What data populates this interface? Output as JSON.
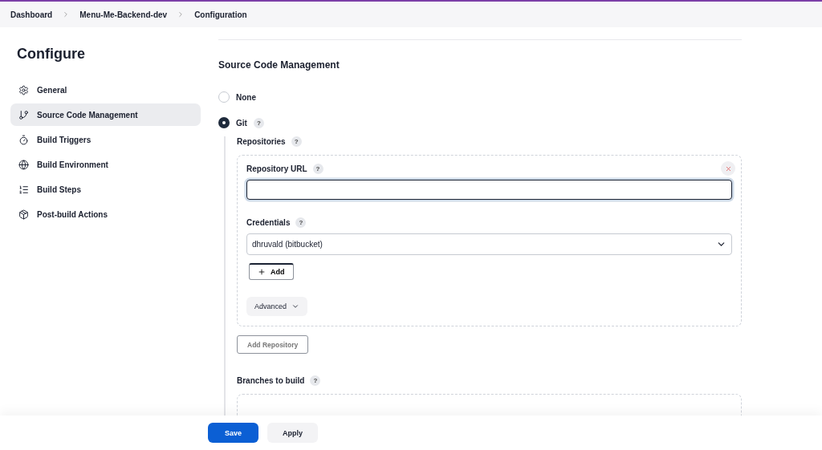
{
  "breadcrumbs": [
    "Dashboard",
    "Menu-Me-Backend-dev",
    "Configuration"
  ],
  "sidebar": {
    "title": "Configure",
    "items": [
      {
        "label": "General",
        "selected": false
      },
      {
        "label": "Source Code Management",
        "selected": true
      },
      {
        "label": "Build Triggers",
        "selected": false
      },
      {
        "label": "Build Environment",
        "selected": false
      },
      {
        "label": "Build Steps",
        "selected": false
      },
      {
        "label": "Post-build Actions",
        "selected": false
      }
    ]
  },
  "section": {
    "title": "Source Code Management",
    "options": [
      {
        "label": "None",
        "selected": false
      },
      {
        "label": "Git",
        "selected": true,
        "help": "?"
      }
    ],
    "repositories": {
      "label": "Repositories",
      "help": "?",
      "card": {
        "url_label": "Repository URL",
        "url_help": "?",
        "url_focused": true,
        "credentials_label": "Credentials",
        "credentials_help": "?",
        "credentials_value": "dhruvald (bitbucket)",
        "add_button": "Add",
        "advanced_button": "Advanced"
      },
      "add_repository_button": "Add Repository"
    },
    "branches": {
      "label": "Branches to build",
      "help": "?"
    }
  },
  "footer": {
    "save": "Save",
    "apply": "Apply"
  }
}
